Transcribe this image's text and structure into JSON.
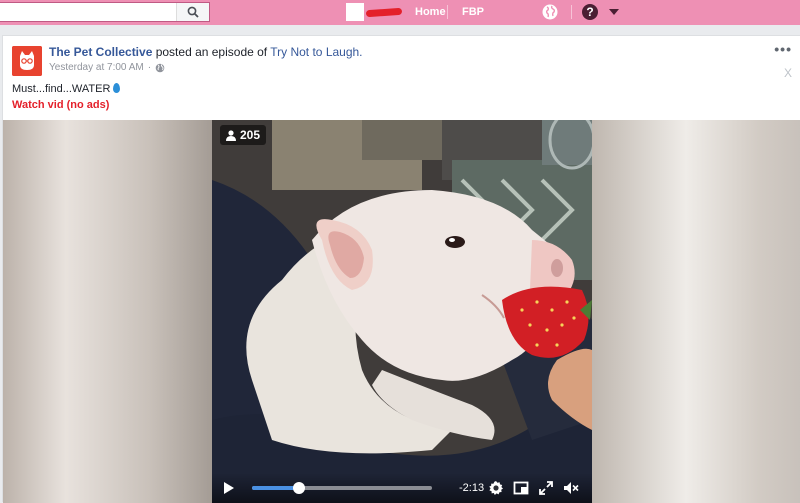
{
  "topbar": {
    "search_placeholder": "",
    "nav_home": "Home",
    "nav_fbp": "FBP",
    "help_label": "?"
  },
  "post": {
    "page_name": "The Pet Collective",
    "action_text": " posted an episode of ",
    "show_name": "Try Not to Laugh.",
    "timestamp": "Yesterday at 7:00 AM",
    "separator": "·",
    "more_label": "•••",
    "hide_label": "X",
    "text": "Must...find...WATER",
    "watch_link": "Watch vid (no ads)"
  },
  "video": {
    "viewer_count": "205",
    "time_remaining": "-2:13",
    "progress_fraction": 0.26,
    "accent_color": "#4a90e2"
  },
  "colors": {
    "topbar": "#ee90b4",
    "link": "#365899",
    "watch_link": "#e4202a",
    "logo_bg": "#e8432f"
  },
  "icons": [
    "search-icon",
    "globe-icon",
    "help-icon",
    "caret-down-icon",
    "page-logo-icon",
    "public-globe-icon",
    "water-drop-icon",
    "viewer-icon",
    "play-icon",
    "settings-icon",
    "pip-icon",
    "fullscreen-icon",
    "mute-icon"
  ]
}
